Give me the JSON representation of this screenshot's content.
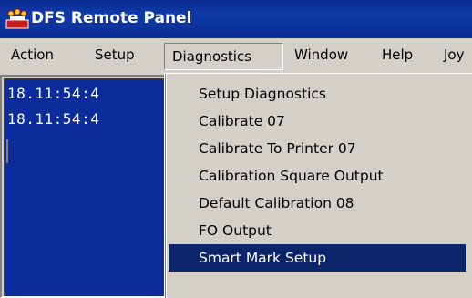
{
  "window": {
    "title": "DFS Remote Panel",
    "icon": "dfs-app-icon"
  },
  "menubar": {
    "items": [
      {
        "label": "Action"
      },
      {
        "label": "Setup"
      },
      {
        "label": "Diagnostics",
        "open": true
      },
      {
        "label": "Window"
      },
      {
        "label": "Help"
      },
      {
        "label": "Joy"
      }
    ]
  },
  "console": {
    "lines": [
      "18.11:54:4",
      "18.11:54:4"
    ]
  },
  "diagnostics_menu": {
    "items": [
      {
        "label": "Setup Diagnostics"
      },
      {
        "label": "Calibrate 07"
      },
      {
        "label": "Calibrate To Printer 07"
      },
      {
        "label": "Calibration Square Output"
      },
      {
        "label": "Default Calibration 08"
      },
      {
        "label": "FO Output"
      },
      {
        "label": "Smart Mark Setup",
        "selected": true
      }
    ]
  },
  "colors": {
    "titlebar": "#0a2a8f",
    "console_bg": "#0c2c9c",
    "selection": "#0c246a",
    "face": "#d4d0c8"
  }
}
